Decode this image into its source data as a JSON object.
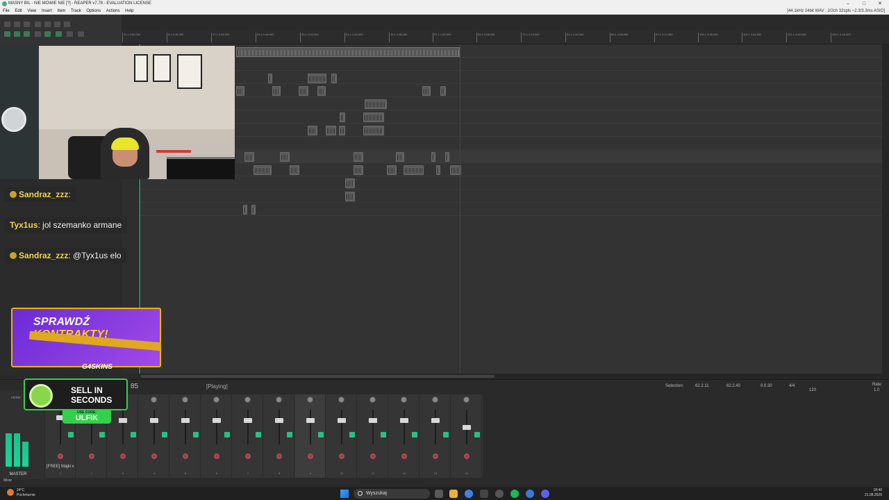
{
  "window": {
    "title": "MASNY BIL - NIE MOWIE NIE [?] - REAPER v7.78 - EVALUATION LICENSE",
    "format": "[44.1kHz 24bit WAV : 2/2ch 32spls ~2.3/3.3ms ASIO]"
  },
  "menu": [
    "File",
    "Edit",
    "View",
    "Insert",
    "Item",
    "Track",
    "Options",
    "Actions",
    "Help"
  ],
  "ruler": {
    "marks": [
      "11.1 0:00.000",
      "9.1 0:16.000",
      "17.1 0:32.000",
      "25.1 0:48.000",
      "33.1 1:04.000",
      "41.1 1:20.000",
      "49.1 1:36.000",
      "57.1 1:52.000",
      "65.1 2:08.000",
      "73.1 2:24.000",
      "81.1 2:40.000",
      "89.1 2:56.000",
      "97.1 3:12.000",
      "105.1 3:28.000",
      "113.1 3:44.000",
      "121.1 4:00.000",
      "129.1 4:16.000"
    ]
  },
  "chat": [
    {
      "user": "Sandraz_zzz",
      "sep": ":",
      "text": ""
    },
    {
      "user": "Tyx1us",
      "sep": ":",
      "text": " jol szemanko armane"
    },
    {
      "user": "Sandraz_zzz",
      "sep": ":",
      "text": " @Tyx1us elo"
    }
  ],
  "ad_contracts": {
    "headline": "SPRAWDŹ ",
    "accent": "KONTRAKTY!",
    "brand": "G4SKINS"
  },
  "ad_sell": {
    "line1": "SELL IN",
    "line2": "SECONDS",
    "code_label": "USE CODE:",
    "code": "ULFIK"
  },
  "transport": {
    "time": "85",
    "state": "[Playing]",
    "selection_label": "Selection:",
    "sel_start": "62.2.11",
    "sel_end": "62.2.40",
    "sel_len": "0.0.30",
    "timesig": "4/4",
    "bpm": "120",
    "rate_label": "Rate:",
    "rate": "1.0"
  },
  "mixer": {
    "master_label": "MASTER",
    "center_label": "center",
    "track_name": "[FREE] Majki x",
    "tab": "Mixer",
    "strip_numbers": [
      "1",
      "2",
      "3",
      "4",
      "5",
      "6",
      "7",
      "8",
      "9",
      "10",
      "11",
      "12",
      "13",
      "14"
    ]
  },
  "taskbar": {
    "temp": "24°C",
    "weather": "Pochmurnie",
    "search_placeholder": "Wyszukaj",
    "time": "18:40",
    "date": "21.08.2026"
  }
}
